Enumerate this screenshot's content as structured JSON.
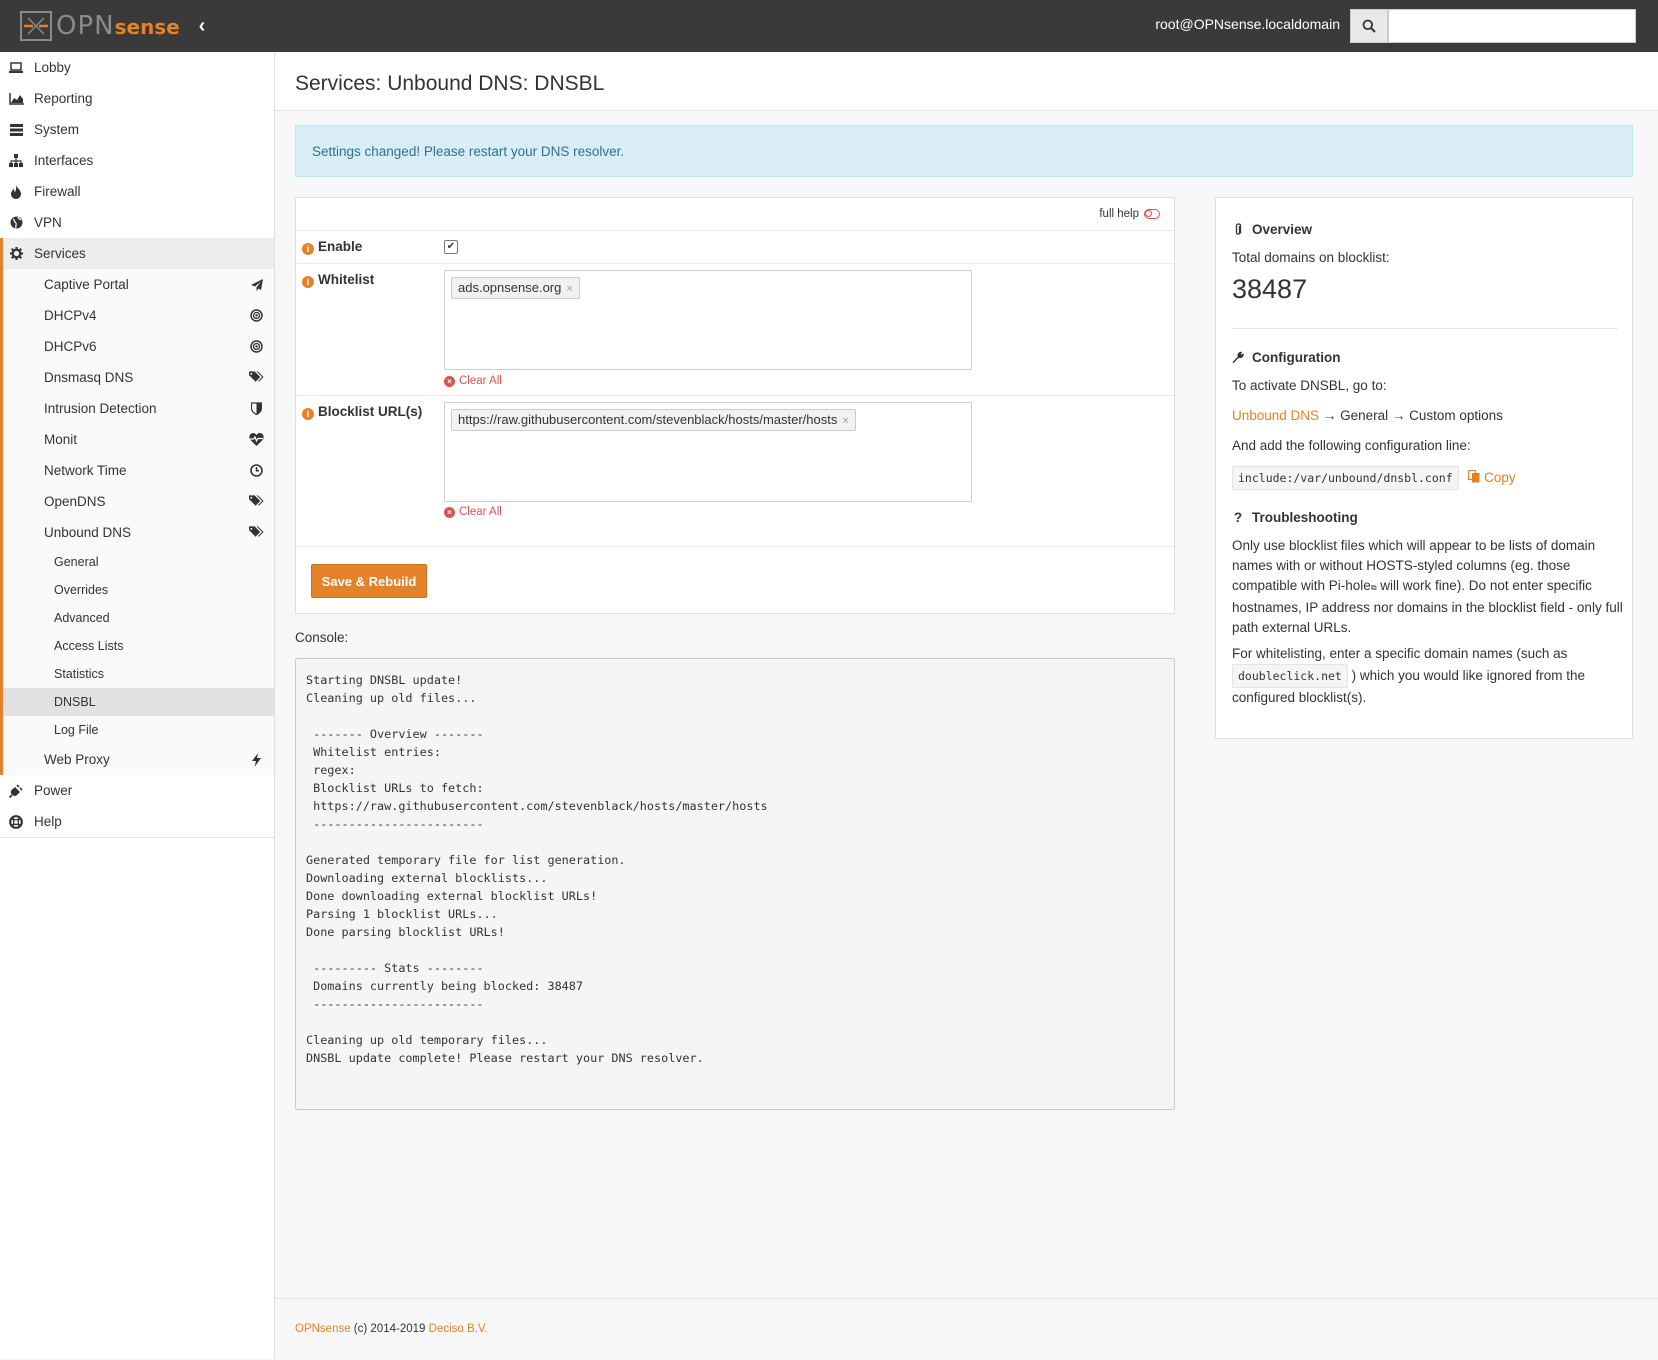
{
  "header": {
    "brand_opn": "OPN",
    "brand_sense": "sense",
    "user": "root@OPNsense.localdomain",
    "search_placeholder": ""
  },
  "sidebar": {
    "top_items": [
      "Lobby",
      "Reporting",
      "System",
      "Interfaces",
      "Firewall",
      "VPN"
    ],
    "services": "Services",
    "services_items": [
      "Captive Portal",
      "DHCPv4",
      "DHCPv6",
      "Dnsmasq DNS",
      "Intrusion Detection",
      "Monit",
      "Network Time",
      "OpenDNS",
      "Unbound DNS"
    ],
    "unbound_items": [
      "General",
      "Overrides",
      "Advanced",
      "Access Lists",
      "Statistics",
      "DNSBL",
      "Log File"
    ],
    "web_proxy": "Web Proxy",
    "bottom_items": [
      "Power",
      "Help"
    ]
  },
  "page": {
    "title": "Services: Unbound DNS: DNSBL",
    "alert": "Settings changed! Please restart your DNS resolver."
  },
  "form": {
    "full_help": "full help",
    "enable_label": "Enable",
    "enable_checked": true,
    "whitelist_label": "Whitelist",
    "whitelist_tag": "ads.opnsense.org",
    "blocklist_label": "Blocklist URL(s)",
    "blocklist_tag": "https://raw.githubusercontent.com/stevenblack/hosts/master/hosts",
    "clear_all": "Clear All",
    "save_button": "Save & Rebuild"
  },
  "console": {
    "label": "Console:",
    "text": "Starting DNSBL update!\nCleaning up old files...\n\n ------- Overview -------\n Whitelist entries:\n regex:\n Blocklist URLs to fetch:\n https://raw.githubusercontent.com/stevenblack/hosts/master/hosts\n ------------------------\n\nGenerated temporary file for list generation.\nDownloading external blocklists...\nDone downloading external blocklist URLs!\nParsing 1 blocklist URLs...\nDone parsing blocklist URLs!\n\n --------- Stats --------\n Domains currently being blocked: 38487\n ------------------------\n\nCleaning up old temporary files...\nDNSBL update complete! Please restart your DNS resolver."
  },
  "overview": {
    "heading": "Overview",
    "total_label": "Total domains on blocklist:",
    "total_value": "38487",
    "config_heading": "Configuration",
    "activate_text": "To activate DNSBL, go to:",
    "path_link": "Unbound DNS",
    "path_arrow1": " → General → Custom options",
    "add_text": "And add the following configuration line:",
    "config_line": "include:/var/unbound/dnsbl.conf",
    "copy": "Copy",
    "trouble_heading": "Troubleshooting",
    "trouble_text_1": "Only use blocklist files which will appear to be lists of domain",
    "trouble_text_2": "names with or without HOSTS-styled columns (eg. those",
    "trouble_text_3": "compatible with Pi-hole",
    "trouble_text_3b": " will work fine). Do not enter specific",
    "trouble_text_4": "hostnames, IP address nor domains in the blocklist field - only full",
    "trouble_text_5": "path external URLs.",
    "white_text_1": "For whitelisting, enter a specific domain names (such as",
    "white_code": "doubleclick.net",
    "white_text_2": ") which you would like ignored from the",
    "white_text_3": "configured blocklist(s)."
  },
  "footer": {
    "brand": "OPNsense",
    "copyright": " (c) 2014-2019 ",
    "company": "Deciso B.V."
  }
}
